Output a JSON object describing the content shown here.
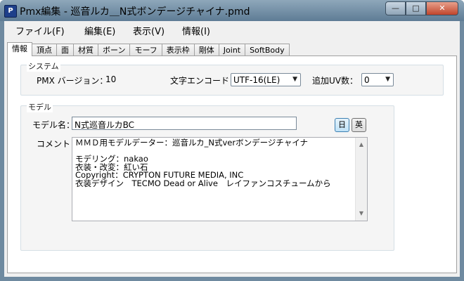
{
  "window": {
    "title": "Pmx編集 - 巡音ルカ＿N式ボンデージチャイナ.pmd",
    "icon": "pmx-app-icon",
    "buttons": {
      "minimize": "—",
      "maximize": "□",
      "close": "✕"
    }
  },
  "menu": {
    "file": "ファイル(F)",
    "edit": "編集(E)",
    "view": "表示(V)",
    "info": "情報(I)"
  },
  "tabs": [
    "情報",
    "頂点",
    "面",
    "材質",
    "ボーン",
    "モーフ",
    "表示枠",
    "剛体",
    "Joint",
    "SoftBody"
  ],
  "active_tab": "情報",
  "system": {
    "group_label": "システム",
    "version_label": "PMX バージョン：",
    "version_value": "10",
    "encoding_label": "文字エンコード：",
    "encoding_value": "UTF-16(LE)",
    "uv_label": "追加UV数：",
    "uv_value": "0"
  },
  "model": {
    "group_label": "モデル",
    "name_label": "モデル名：",
    "name_value": "N式巡音ルカBC",
    "lang_jp": "日",
    "lang_en": "英",
    "comment_label": "コメント：",
    "comment_lines": [
      "ＭＭＤ用モデルデーター：巡音ルカ_N式verボンデージチャイナ",
      "",
      "モデリング：nakao",
      "衣装・改変：紅い石",
      "Copyright：CRYPTON FUTURE MEDIA, INC",
      "衣装デザイン　TECMO Dead or Alive　レイファンコスチュームから"
    ]
  }
}
